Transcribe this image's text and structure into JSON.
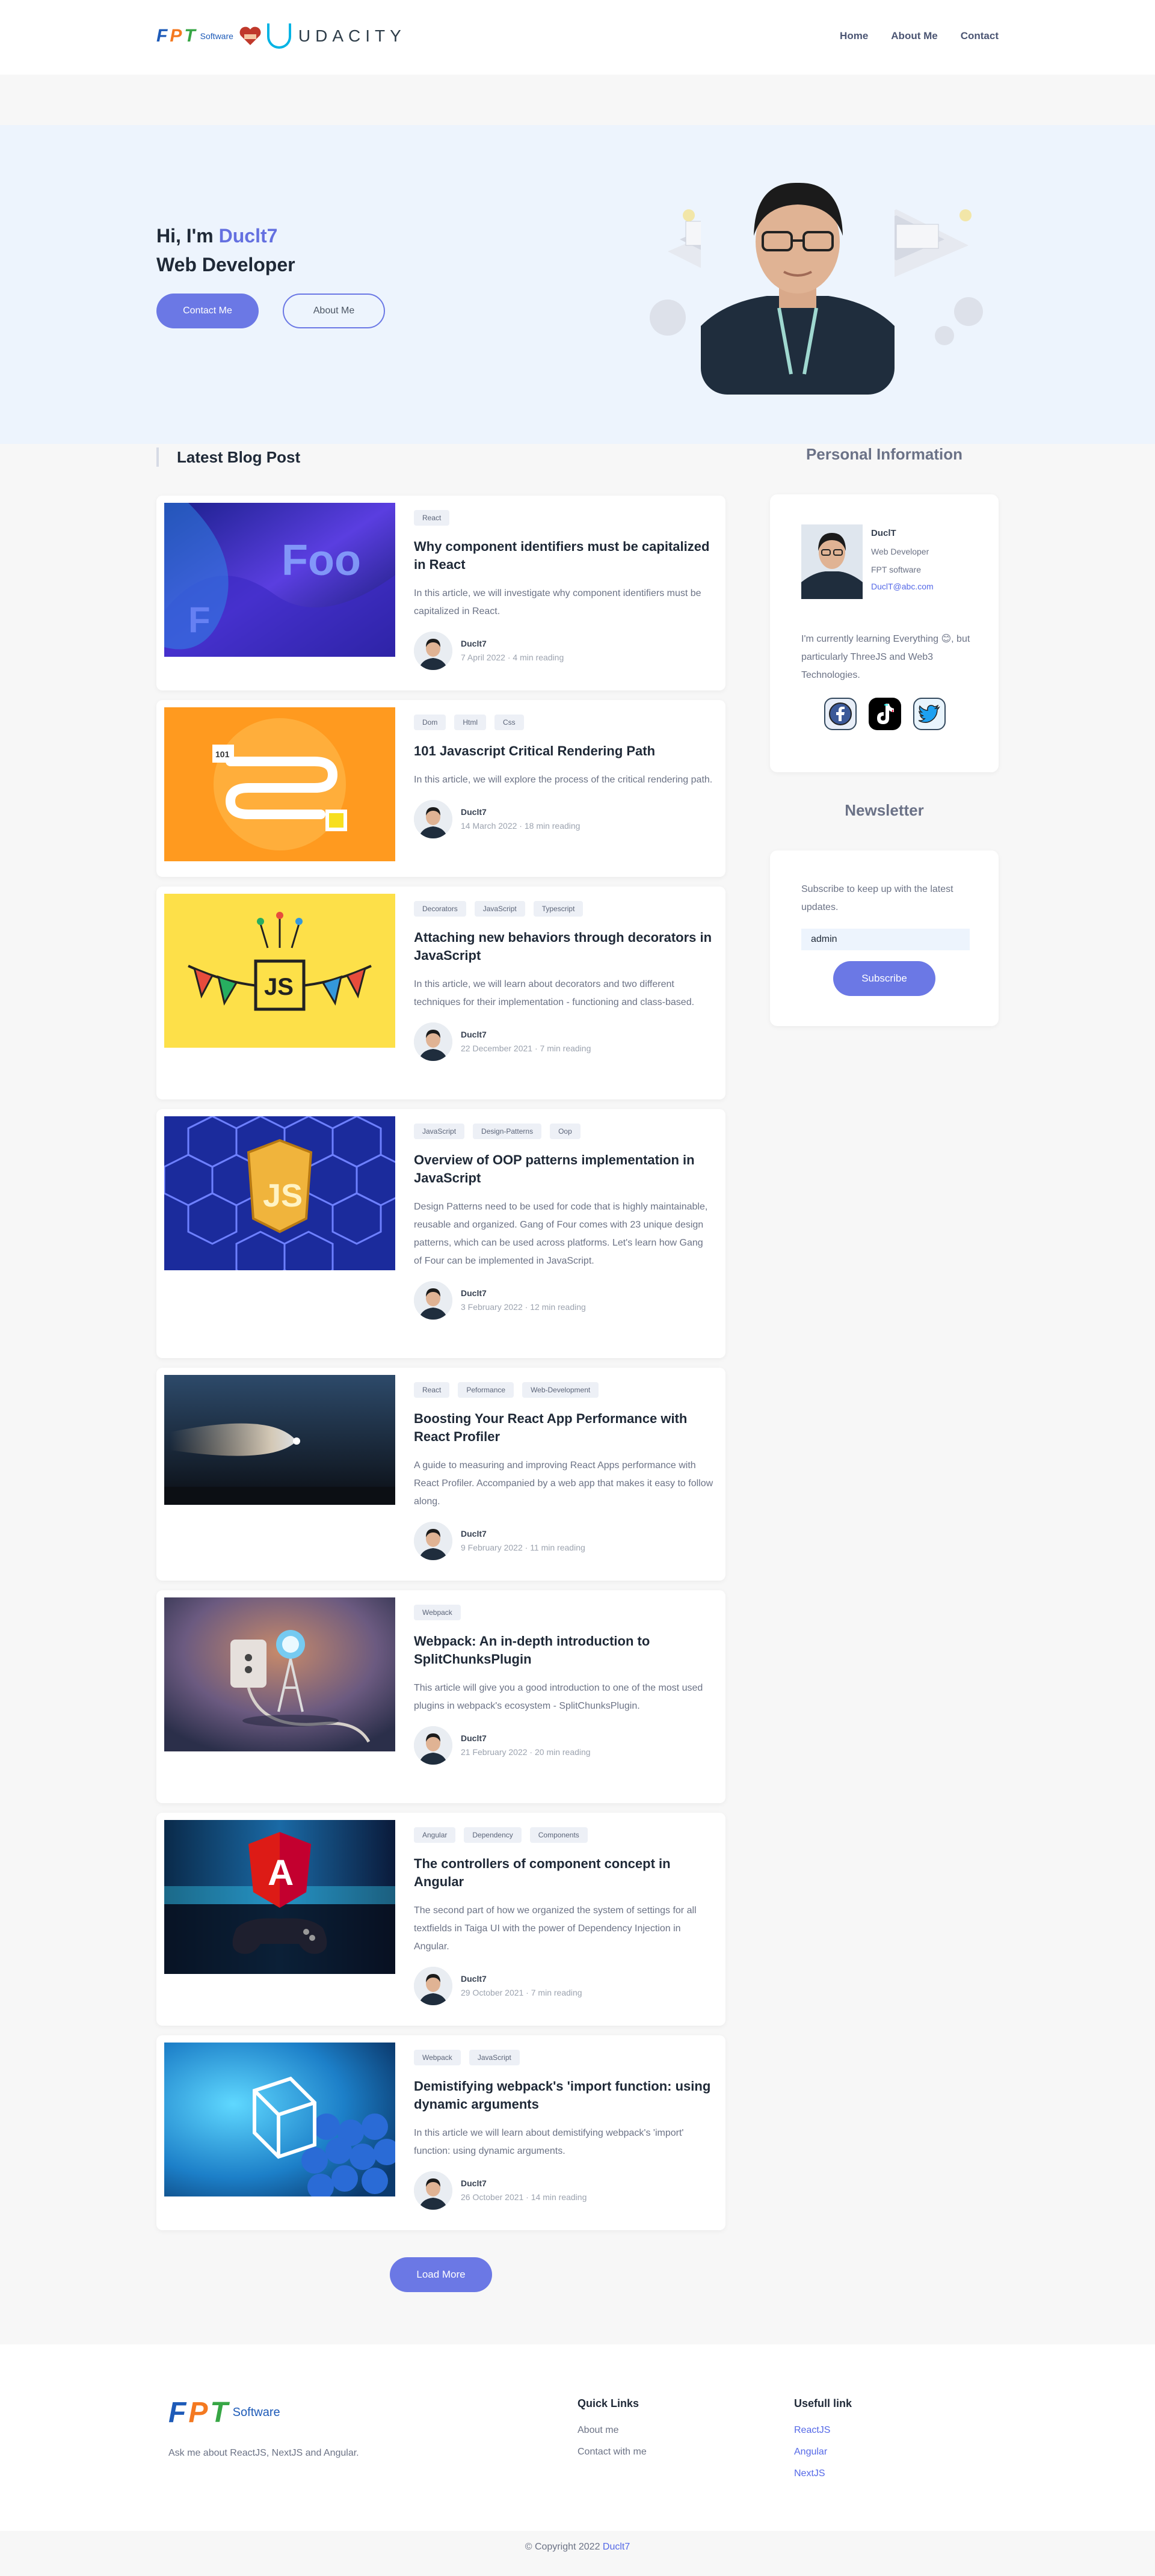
{
  "header": {
    "brand_fpt_letters": [
      "F",
      "P",
      "T"
    ],
    "brand_fpt_software": "Software",
    "brand_udacity": "UDACITY",
    "nav": [
      {
        "label": "Home"
      },
      {
        "label": "About Me"
      },
      {
        "label": "Contact"
      }
    ]
  },
  "hero": {
    "greeting_prefix": "Hi, I'm ",
    "name": "Duclt7",
    "role": "Web Developer",
    "contact_button": "Contact Me",
    "about_button": "About Me"
  },
  "blog": {
    "heading": "Latest Blog Post",
    "posts": [
      {
        "tags": [
          "React"
        ],
        "title": "Why component identifiers must be capitalized in React",
        "description": "In this article, we will investigate why component identifiers must be capitalized in React.",
        "author": "Duclt7",
        "date": "7 April 2022",
        "read": "4 min reading",
        "image_text": "Foo"
      },
      {
        "tags": [
          "Dom",
          "Html",
          "Css"
        ],
        "title": "101 Javascript Critical Rendering Path",
        "description": "In this article, we will explore the process of the critical rendering path.",
        "author": "Duclt7",
        "date": "14 March 2022",
        "read": "18 min reading",
        "image_text": "101"
      },
      {
        "tags": [
          "Decorators",
          "JavaScript",
          "Typescript"
        ],
        "title": "Attaching new behaviors through decorators in JavaScript",
        "description": "In this article, we will learn about decorators and two different techniques for their implementation - functioning and class-based.",
        "author": "Duclt7",
        "date": "22 December 2021",
        "read": "7 min reading",
        "image_text": "JS"
      },
      {
        "tags": [
          "JavaScript",
          "Design-Patterns",
          "Oop"
        ],
        "title": "Overview of OOP patterns implementation in JavaScript",
        "description": "Design Patterns need to be used for code that is highly maintainable, reusable and organized. Gang of Four comes with 23 unique design patterns, which can be used across platforms. Let's learn how Gang of Four can be implemented in JavaScript.",
        "author": "Duclt7",
        "date": "3 February 2022",
        "read": "12 min reading",
        "image_text": "JS"
      },
      {
        "tags": [
          "React",
          "Peformance",
          "Web-Development"
        ],
        "title": "Boosting Your React App Performance with React Profiler",
        "description": "A guide to measuring and improving React Apps performance with React Profiler. Accompanied by a web app that makes it easy to follow along.",
        "author": "Duclt7",
        "date": "9 February 2022",
        "read": "11 min reading",
        "image_text": ""
      },
      {
        "tags": [
          "Webpack"
        ],
        "title": "Webpack: An in-depth introduction to SplitChunksPlugin",
        "description": "This article will give you a good introduction to one of the most used plugins in webpack's ecosystem - SplitChunksPlugin.",
        "author": "Duclt7",
        "date": "21 February 2022",
        "read": "20 min reading",
        "image_text": ""
      },
      {
        "tags": [
          "Angular",
          "Dependency",
          "Components"
        ],
        "title": "The controllers of component concept in Angular",
        "description": "The second part of how we organized the system of settings for all textfields in Taiga UI with the power of Dependency Injection in Angular.",
        "author": "Duclt7",
        "date": "29 October 2021",
        "read": "7 min reading",
        "image_text": "A"
      },
      {
        "tags": [
          "Webpack",
          "JavaScript"
        ],
        "title": "Demistifying webpack's 'import function: using dynamic arguments",
        "description": "In this article we will learn about demistifying webpack's 'import' function: using dynamic arguments.",
        "author": "Duclt7",
        "date": "26 October 2021",
        "read": "14 min reading",
        "image_text": ""
      }
    ],
    "load_more": "Load More"
  },
  "sidebar": {
    "personal_heading": "Personal Information",
    "name": "DuclT",
    "role": "Web Developer",
    "company": "FPT software",
    "email": "DuclT@abc.com",
    "bio": "I'm currently learning Everything 😊, but particularly ThreeJS and Web3 Technologies.",
    "socials": [
      {
        "icon": "facebook-icon",
        "color": "#3b5998",
        "glyph": "f"
      },
      {
        "icon": "tiktok-icon",
        "color": "#000000",
        "glyph": "♪"
      },
      {
        "icon": "twitter-icon",
        "color": "#1da1f2",
        "glyph": "t"
      }
    ],
    "newsletter_heading": "Newsletter",
    "newsletter_text": "Subscribe to keep up with the latest updates.",
    "newsletter_value": "admin",
    "subscribe_button": "Subscribe"
  },
  "footer": {
    "tagline": "Ask me about ReactJS, NextJS and Angular.",
    "quick_links_heading": "Quick Links",
    "quick_links": [
      "About me",
      "Contact with me"
    ],
    "useful_heading": "Usefull link",
    "useful_links": [
      "ReactJS",
      "Angular",
      "NextJS"
    ],
    "copyright_prefix": "© Copyright 2022 ",
    "copyright_owner": "Duclt7"
  },
  "colors": {
    "accent": "#6b78e5",
    "hero_bg": "#edf4fd",
    "link": "#5468e7"
  }
}
